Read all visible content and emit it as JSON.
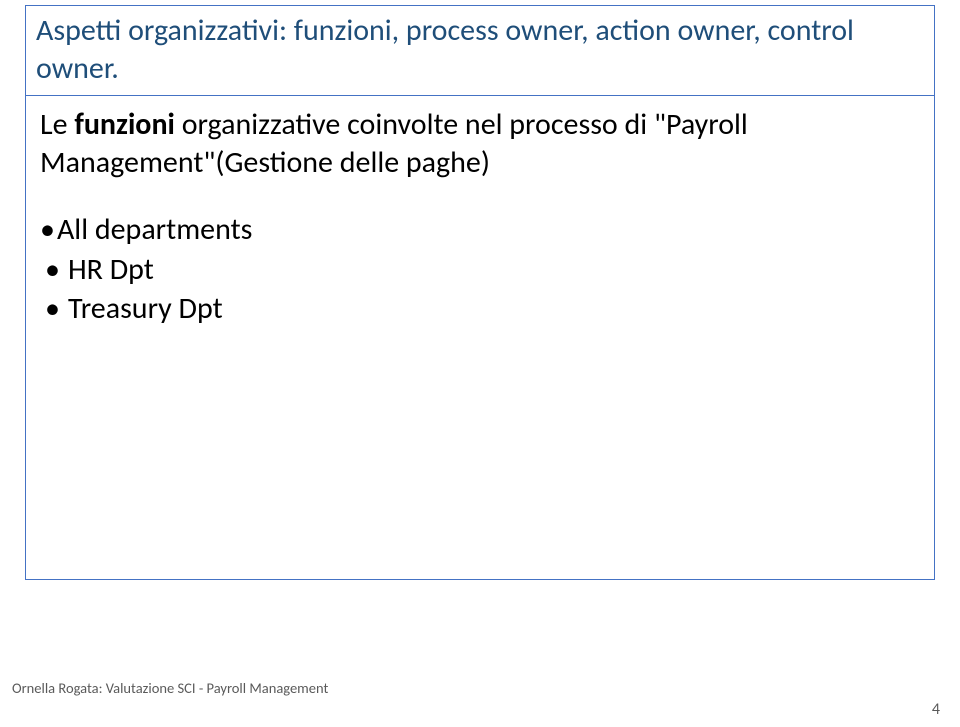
{
  "title": "Aspetti organizzativi: funzioni, process owner, action owner, control owner.",
  "intro": {
    "pre": "Le ",
    "bold": "funzioni",
    "post": " organizzative coinvolte nel processo di \"Payroll Management\"(Gestione delle paghe)"
  },
  "bullets": [
    {
      "label": "All departments",
      "style": "big"
    },
    {
      "label": "HR Dpt",
      "style": "small"
    },
    {
      "label": "Treasury Dpt",
      "style": "small"
    }
  ],
  "footer": "Ornella Rogata: Valutazione SCI  - Payroll Management",
  "page_number": "4"
}
